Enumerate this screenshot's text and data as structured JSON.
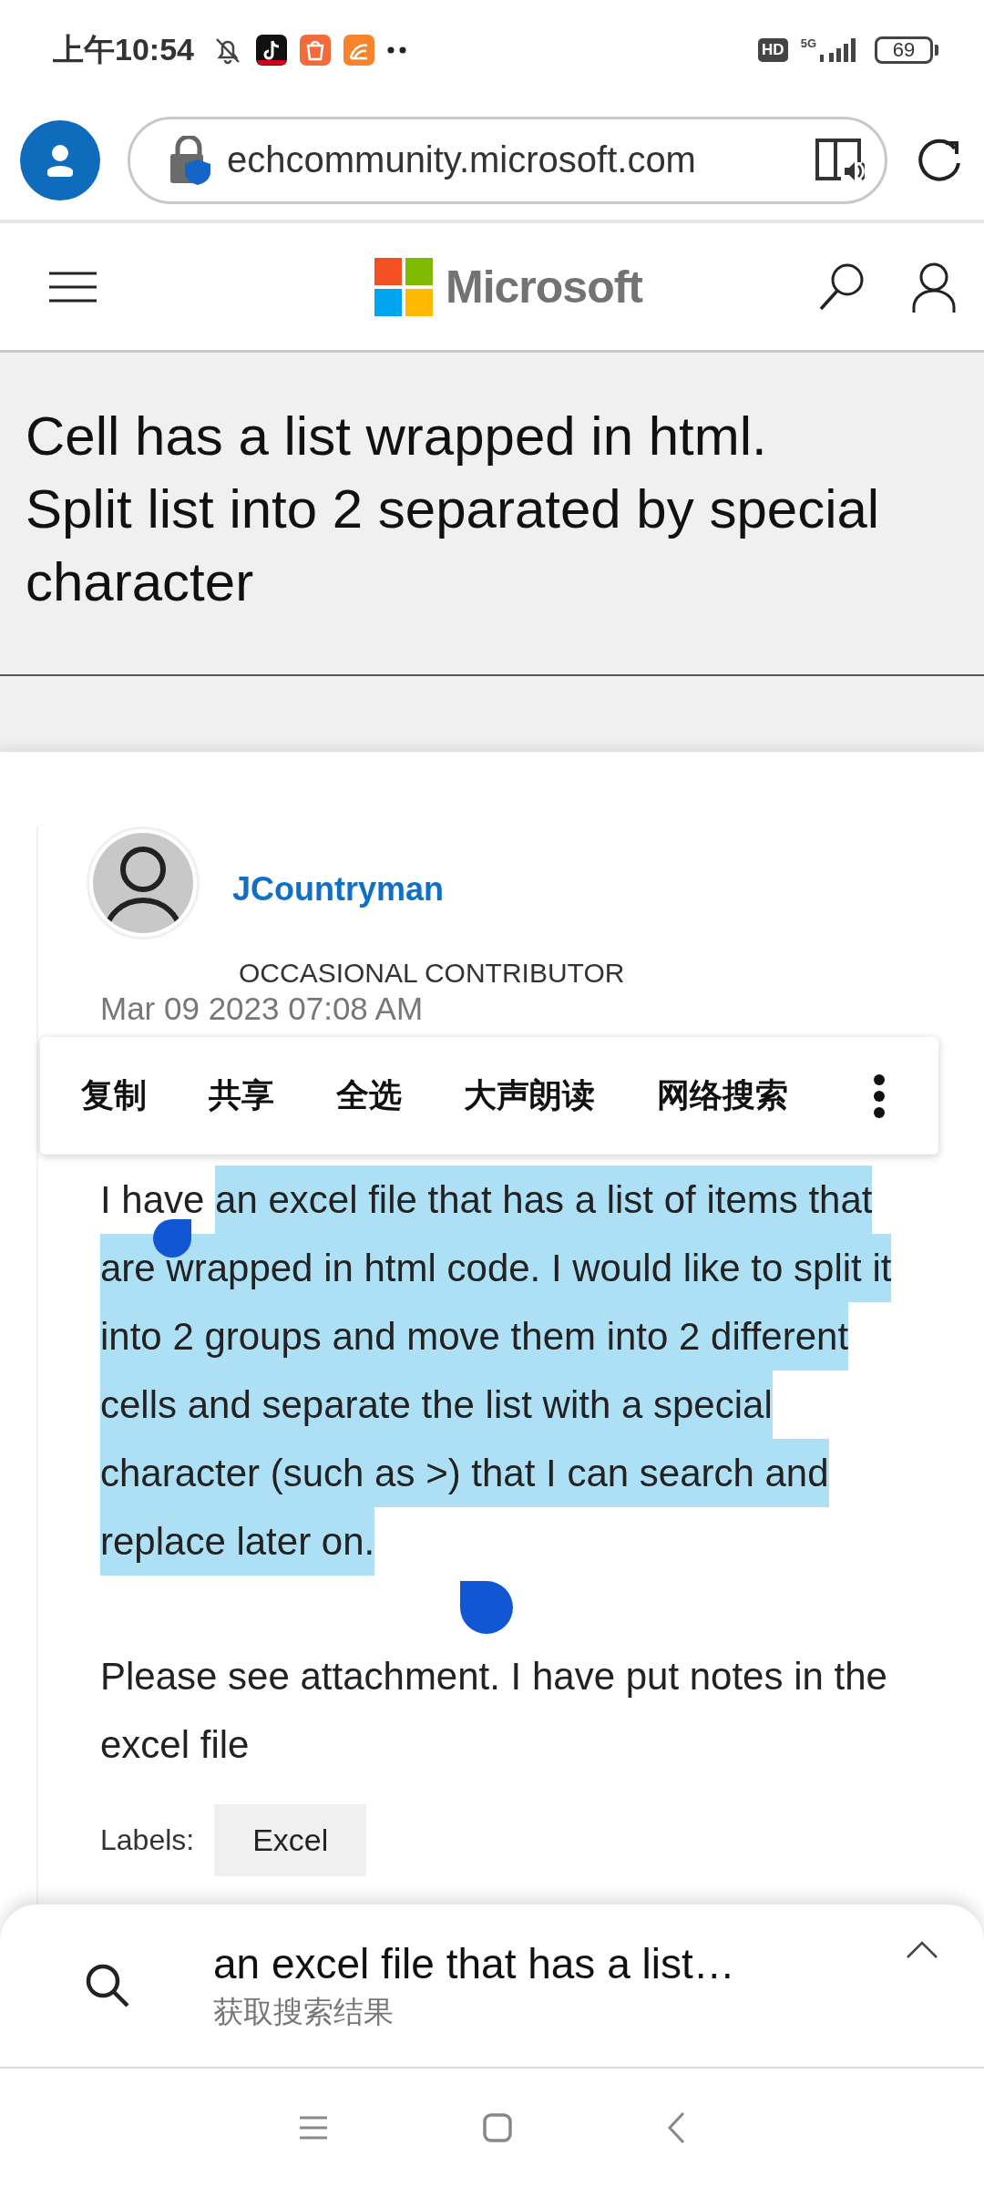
{
  "status_bar": {
    "time": "上午10:54",
    "hd_badge": "HD",
    "network": "5G",
    "battery": "69"
  },
  "browser": {
    "url": "echcommunity.microsoft.com"
  },
  "site_header": {
    "brand": "Microsoft"
  },
  "title_sentences": [
    "Cell has a list wrapped in html.",
    "Split list into 2 separated by special character"
  ],
  "post": {
    "author": "JCountryman",
    "role": "OCCASIONAL CONTRIBUTOR",
    "date": "Mar 09 2023 07:08 AM",
    "paragraphs": [
      {
        "segments": [
          {
            "text": "I have ",
            "selected": false
          },
          {
            "text": "an excel file that has a list of items that are wrapped in html code. I would like to split it into 2 groups and move them into 2 different cells and separate the list with a special character (such as >) that I can search and replace later on.",
            "selected": true
          }
        ]
      },
      {
        "segments": [
          {
            "text": "Please see attachment. I have put notes in the excel file",
            "selected": false
          }
        ]
      }
    ],
    "labels_caption": "Labels:",
    "labels": [
      "Excel"
    ]
  },
  "context_menu": {
    "items": [
      "复制",
      "共享",
      "全选",
      "大声朗读",
      "网络搜索"
    ]
  },
  "search_sheet": {
    "query": "an excel file that has a list…",
    "hint": "获取搜索结果"
  }
}
